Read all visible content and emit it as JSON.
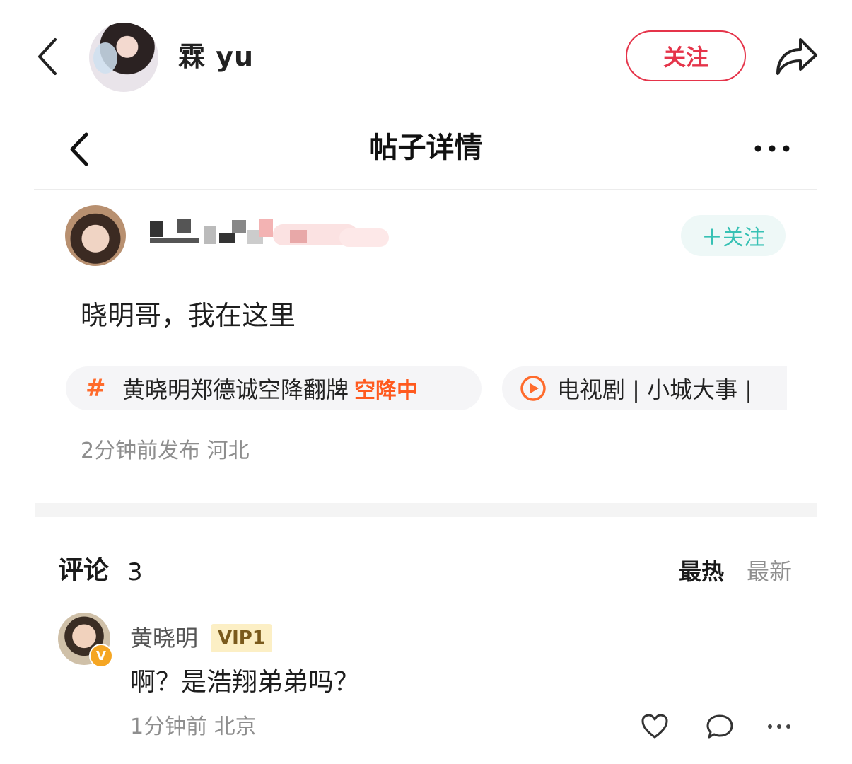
{
  "top_bar": {
    "username": "霖 yu",
    "follow_label": "关注"
  },
  "post_header": {
    "title": "帖子详情"
  },
  "post": {
    "follow_label": "＋关注",
    "text": "晓明哥，我在这里",
    "tags": [
      {
        "label": "黄晓明郑德诚空降翻牌",
        "badge": "空降中",
        "icon": "hash-icon"
      },
      {
        "label": "电视剧 | 小城大事 | ",
        "icon": "play-circle-icon"
      }
    ],
    "meta": "2分钟前发布 河北"
  },
  "comments": {
    "title": "评论",
    "count": "3",
    "sort_hot": "最热",
    "sort_new": "最新",
    "items": [
      {
        "name": "黄晓明",
        "badge": "VIP1",
        "verified_mark": "V",
        "text": "啊？是浩翔弟弟吗？",
        "meta": "1分钟前 北京"
      }
    ]
  },
  "colors": {
    "follow_red": "#e5344a",
    "follow_teal": "#37c1b4",
    "tag_orange": "#ff6b2c",
    "vip_bg": "#fcefc5"
  }
}
